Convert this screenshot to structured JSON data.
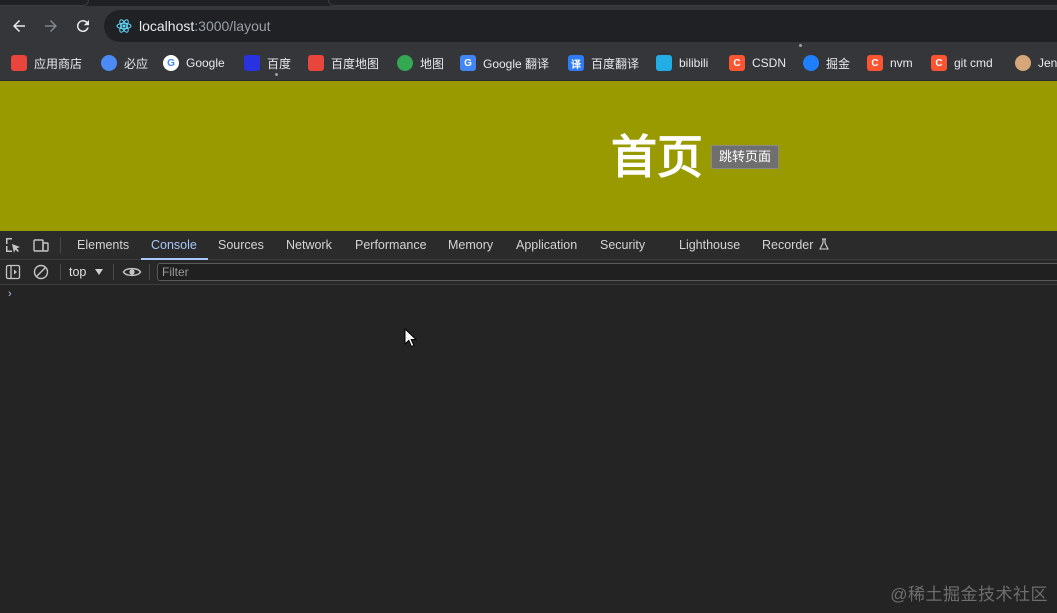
{
  "browser": {
    "url_host": "localhost",
    "url_path": ":3000/layout",
    "bookmarks": [
      {
        "label": "应用商店",
        "icon": "apps-grid-icon",
        "color": "#e8453c",
        "glyph": ""
      },
      {
        "label": "必应",
        "icon": "search-icon",
        "color": "#4c8bf5",
        "glyph": ""
      },
      {
        "label": "Google",
        "icon": "google-icon",
        "color": "#ffffff",
        "glyph": "G"
      },
      {
        "label": "百度",
        "icon": "baidu-paw-icon",
        "color": "#2932e1",
        "glyph": ""
      },
      {
        "label": "百度地图",
        "icon": "map-pin-icon",
        "color": "#e8453c",
        "glyph": ""
      },
      {
        "label": "地图",
        "icon": "google-maps-pin-icon",
        "color": "#34a853",
        "glyph": ""
      },
      {
        "label": "Google 翻译",
        "icon": "translate-icon",
        "color": "#4285f4",
        "glyph": "G"
      },
      {
        "label": "百度翻译",
        "icon": "translate-icon",
        "color": "#2f7cf6",
        "glyph": "译"
      },
      {
        "label": "bilibili",
        "icon": "tv-icon",
        "color": "#23ade5",
        "glyph": ""
      },
      {
        "label": "CSDN",
        "icon": "csdn-icon",
        "color": "#fc5531",
        "glyph": "C"
      },
      {
        "label": "掘金",
        "icon": "juejin-icon",
        "color": "#1e80ff",
        "glyph": ""
      },
      {
        "label": "nvm",
        "icon": "csdn-icon",
        "color": "#fc5531",
        "glyph": "C"
      },
      {
        "label": "git cmd",
        "icon": "csdn-icon",
        "color": "#fc5531",
        "glyph": "C"
      },
      {
        "label": "Jen",
        "icon": "jenkins-icon",
        "color": "#d6a77a",
        "glyph": ""
      }
    ]
  },
  "page": {
    "title": "首页",
    "jump_button": "跳转页面",
    "background": "#999900"
  },
  "devtools": {
    "tabs": [
      "Elements",
      "Console",
      "Sources",
      "Network",
      "Performance",
      "Memory",
      "Application",
      "Security",
      "Lighthouse",
      "Recorder"
    ],
    "active_tab": "Console",
    "context": "top",
    "filter_placeholder": "Filter",
    "prompt": "›"
  },
  "watermark": "@稀土掘金技术社区"
}
